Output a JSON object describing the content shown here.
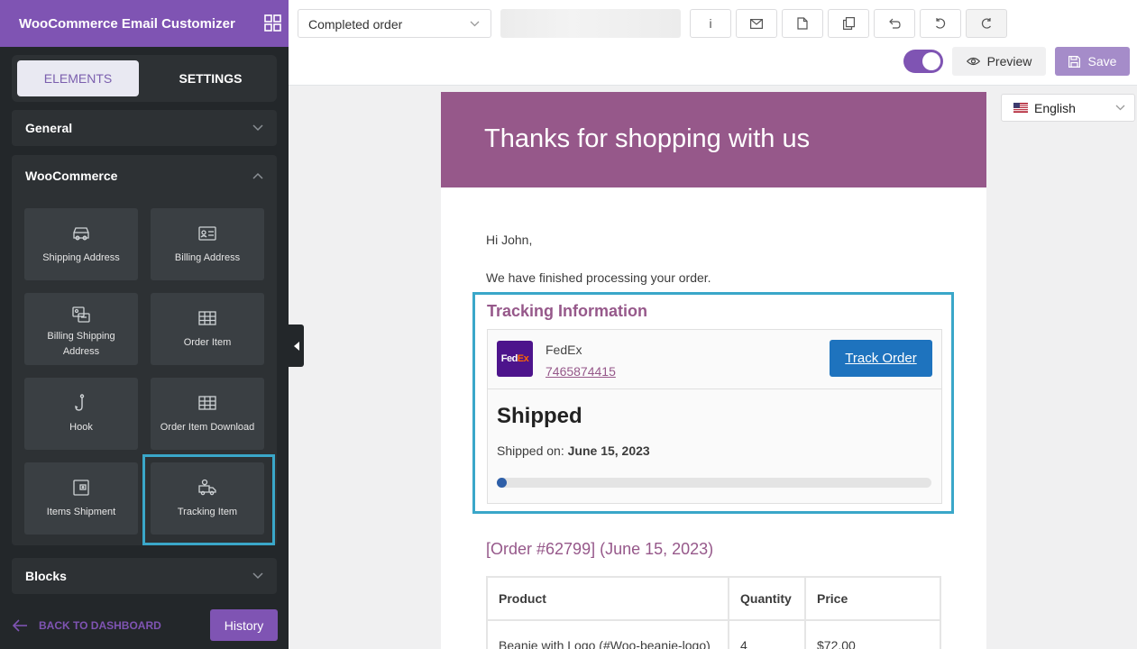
{
  "sidebar": {
    "title": "WooCommerce Email Customizer",
    "tabs": {
      "elements": "ELEMENTS",
      "settings": "SETTINGS"
    },
    "sections": {
      "general": "General",
      "woocommerce": "WooCommerce",
      "blocks": "Blocks"
    },
    "woo_elements": [
      {
        "label": "Shipping Address",
        "icon": "truck-icon"
      },
      {
        "label": "Billing Address",
        "icon": "id-card-icon"
      },
      {
        "label": "Billing Shipping Address",
        "icon": "address-card-icon"
      },
      {
        "label": "Order Item",
        "icon": "table-icon"
      },
      {
        "label": "Hook",
        "icon": "hook-icon"
      },
      {
        "label": "Order Item Download",
        "icon": "table-icon"
      },
      {
        "label": "Items Shipment",
        "icon": "wallet-icon"
      },
      {
        "label": "Tracking Item",
        "icon": "tracking-truck-icon"
      }
    ],
    "back_label": "BACK TO DASHBOARD",
    "history_label": "History"
  },
  "toolbar": {
    "template_value": "Completed order",
    "tools": [
      "info-icon",
      "mail-icon",
      "file-icon",
      "copy-icon",
      "undo-icon",
      "redo-icon",
      "refresh-icon"
    ],
    "info_glyph": "i",
    "preview_label": "Preview",
    "save_label": "Save",
    "toggle_on": true
  },
  "language": {
    "value": "English"
  },
  "email": {
    "header_heading": "Thanks for shopping with us",
    "greeting": "Hi John,",
    "intro": "We have finished processing your order.",
    "tracking": {
      "title": "Tracking Information",
      "carrier": "FedEx",
      "logo_text_fed": "Fed",
      "logo_text_ex": "Ex",
      "tracking_number": "7465874415",
      "button_label": "Track Order",
      "status": "Shipped",
      "shipped_on_label": "Shipped on:",
      "shipped_on_date": "June 15, 2023",
      "progress": 0.02
    },
    "order_heading": "[Order #62799] (June 15, 2023)",
    "table": {
      "headers": [
        "Product",
        "Quantity",
        "Price"
      ],
      "rows": [
        [
          "Beanie with Logo (#Woo-beanie-logo)",
          "4",
          "$72.00"
        ]
      ]
    }
  },
  "colors": {
    "brand_purple": "#7f54b3",
    "email_header": "#96588a",
    "selection_outline": "#3aa7c9",
    "track_button": "#1e73be"
  }
}
